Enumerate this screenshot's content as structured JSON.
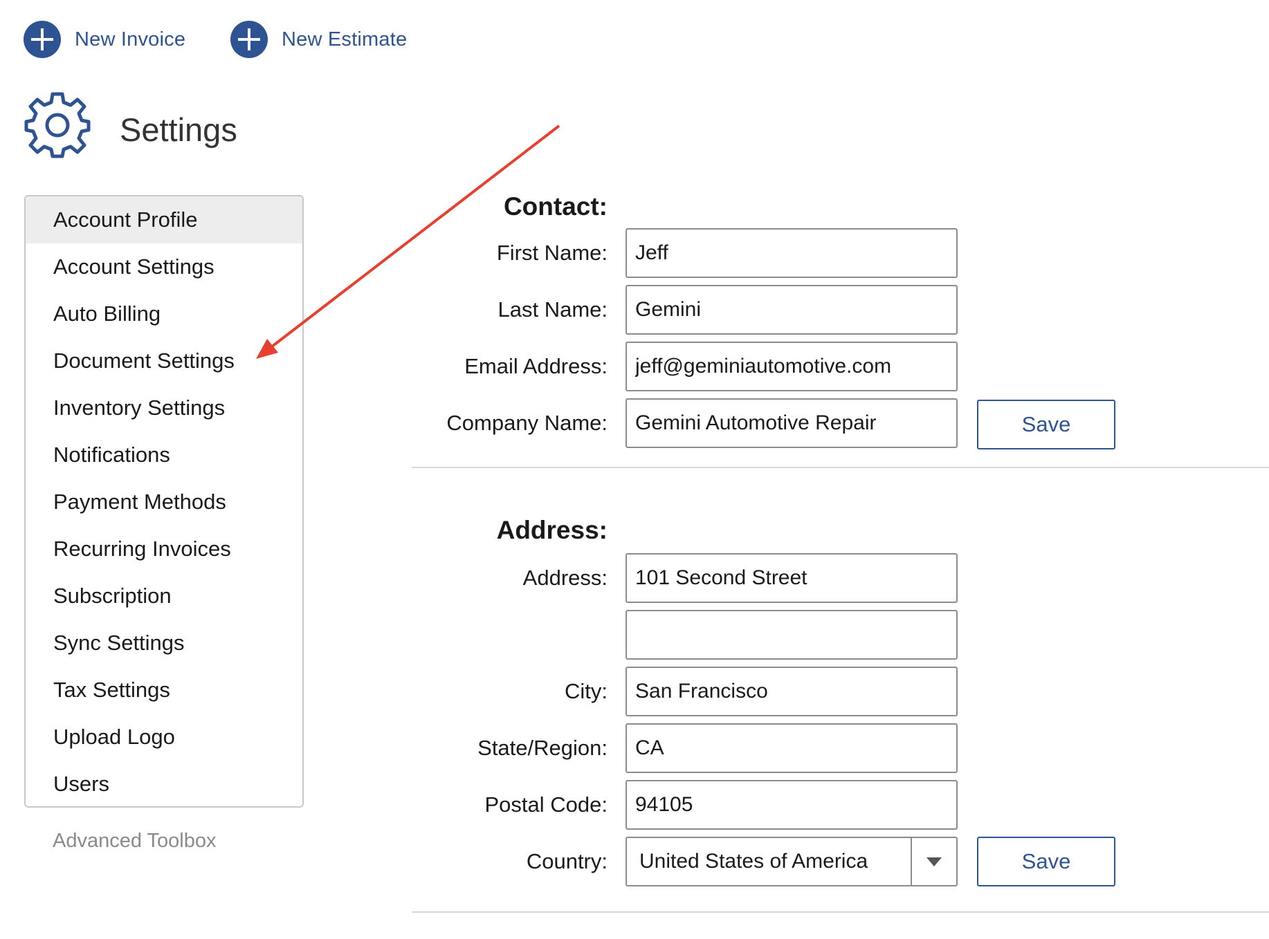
{
  "top_actions": {
    "new_invoice": "New Invoice",
    "new_estimate": "New Estimate"
  },
  "page": {
    "title": "Settings",
    "icon": "gear-icon"
  },
  "sidebar": {
    "items": [
      {
        "label": "Account Profile",
        "active": true
      },
      {
        "label": "Account Settings"
      },
      {
        "label": "Auto Billing"
      },
      {
        "label": "Document Settings"
      },
      {
        "label": "Inventory Settings"
      },
      {
        "label": "Notifications"
      },
      {
        "label": "Payment Methods"
      },
      {
        "label": "Recurring Invoices"
      },
      {
        "label": "Subscription"
      },
      {
        "label": "Sync Settings"
      },
      {
        "label": "Tax Settings"
      },
      {
        "label": "Upload Logo"
      },
      {
        "label": "Users"
      }
    ],
    "advanced_toolbox": "Advanced Toolbox"
  },
  "contact": {
    "heading": "Contact:",
    "first_name_label": "First Name:",
    "first_name_value": "Jeff",
    "last_name_label": "Last Name:",
    "last_name_value": "Gemini",
    "email_label": "Email Address:",
    "email_value": "jeff@geminiautomotive.com",
    "company_label": "Company Name:",
    "company_value": "Gemini Automotive Repair",
    "save_label": "Save"
  },
  "address": {
    "heading": "Address:",
    "address_label": "Address:",
    "address_line1": "101 Second Street",
    "address_line2": "",
    "city_label": "City:",
    "city_value": "San Francisco",
    "state_label": "State/Region:",
    "state_value": "CA",
    "postal_label": "Postal Code:",
    "postal_value": "94105",
    "country_label": "Country:",
    "country_value": "United States of America",
    "save_label": "Save"
  },
  "colors": {
    "accent": "#2e5393",
    "annotation_arrow": "#e8402f",
    "active_item_bg": "#ededed"
  }
}
